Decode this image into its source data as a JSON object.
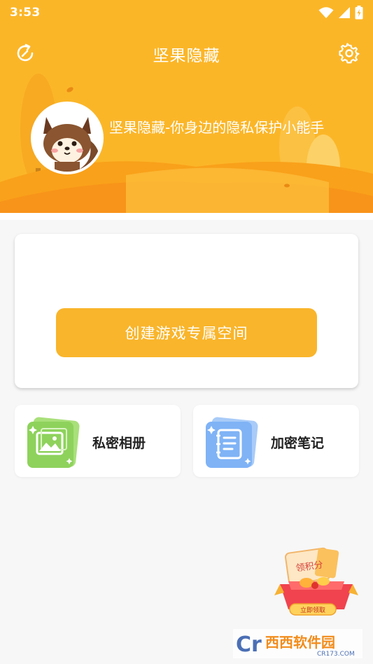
{
  "status_bar": {
    "time": "3:53",
    "icons": [
      "wifi-icon",
      "signal-icon",
      "battery-charging-icon"
    ]
  },
  "header": {
    "title": "坚果隐藏",
    "left_icon": "refresh-icon",
    "right_icon": "settings-gear-icon",
    "tagline": "坚果隐藏-你身边的隐私保护小能手",
    "avatar": "squirrel-avatar"
  },
  "main_card": {
    "button_label": "创建游戏专属空间"
  },
  "features": [
    {
      "label": "私密相册",
      "icon": "photo-album-icon",
      "color": "#8ed25c"
    },
    {
      "label": "加密笔记",
      "icon": "notebook-icon",
      "color": "#7fb3f6"
    }
  ],
  "reward": {
    "tag_text": "领积分",
    "button_text": "立即领取"
  },
  "watermark": {
    "brand_text": "西西软件园",
    "url_text": "CR173.COM"
  },
  "colors": {
    "accent": "#fbb628",
    "button": "#f9b52b",
    "background": "#f7f7f7"
  }
}
